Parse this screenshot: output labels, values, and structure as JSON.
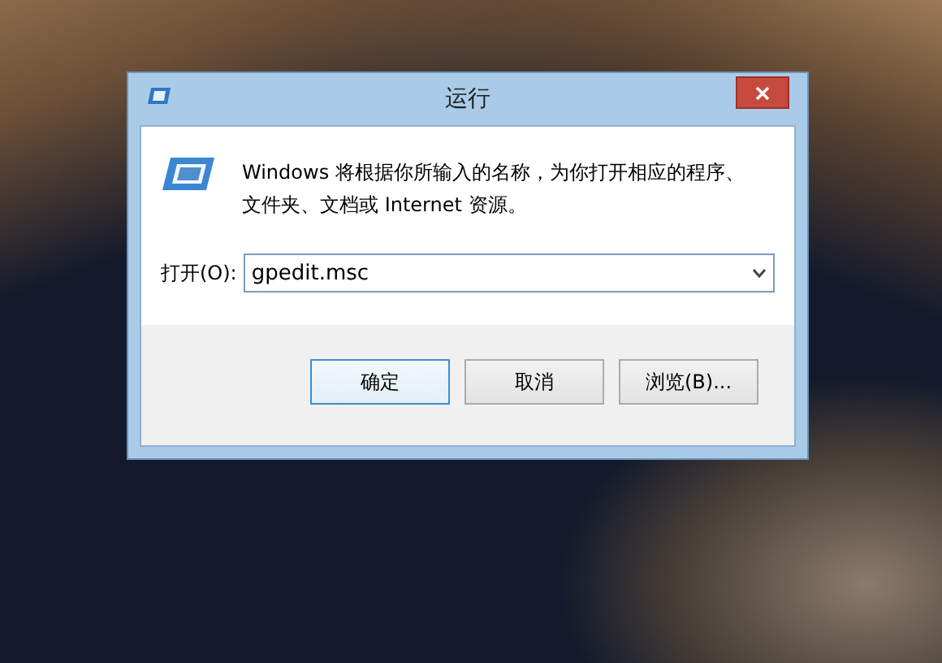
{
  "window": {
    "title": "运行"
  },
  "message": "Windows 将根据你所输入的名称，为你打开相应的程序、文件夹、文档或 Internet 资源。",
  "open_field": {
    "label": "打开(O):",
    "value": "gpedit.msc"
  },
  "buttons": [
    {
      "label": "确定",
      "default": true
    },
    {
      "label": "取消",
      "default": false
    },
    {
      "label": "浏览(B)...",
      "default": false
    }
  ]
}
